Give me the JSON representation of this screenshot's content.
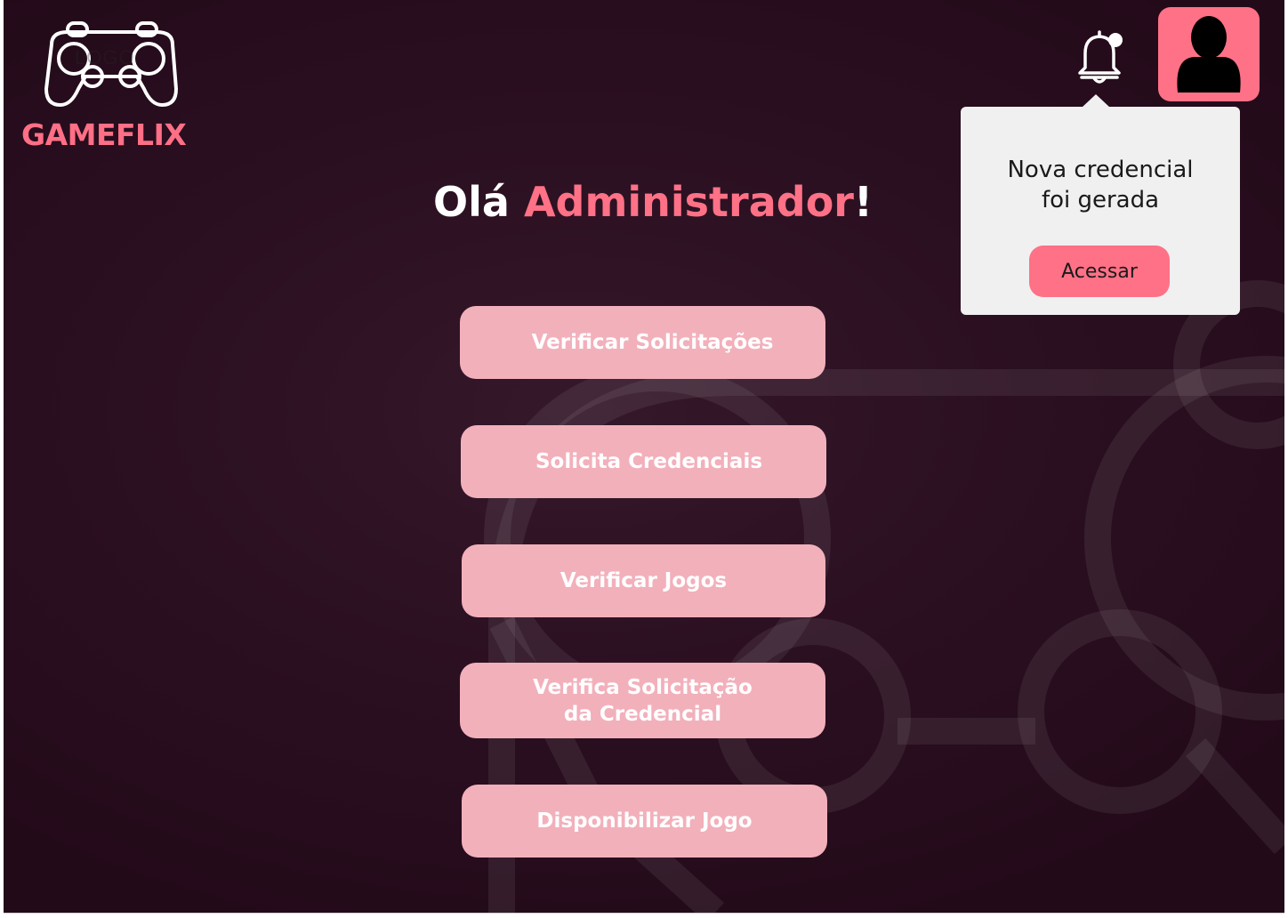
{
  "app": {
    "brand_name": "GAMEFLIX",
    "logo_ghost_text": "LOGO",
    "accent_color": "#ff7186",
    "background_color": "#2a0f20"
  },
  "header": {
    "notification_icon": "bell-icon",
    "notification_has_unread": true,
    "profile_icon": "user-icon"
  },
  "notification_popup": {
    "message": "Nova credencial\nfoi gerada",
    "action_label": "Acessar"
  },
  "greeting": {
    "prefix": "Olá ",
    "name": "Administrador",
    "suffix": "!"
  },
  "menu": {
    "items": [
      {
        "label": "Verificar Solicitações"
      },
      {
        "label": "Solicita Credenciais"
      },
      {
        "label": "Verificar Jogos"
      },
      {
        "label": "Verifica Solicitação\nda Credencial"
      },
      {
        "label": "Disponibilizar Jogo"
      }
    ]
  }
}
